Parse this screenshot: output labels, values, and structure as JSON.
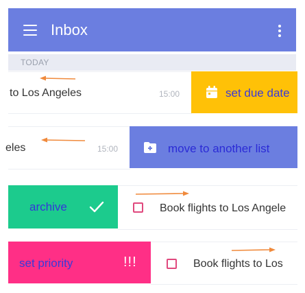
{
  "header": {
    "title": "Inbox"
  },
  "section": {
    "label": "TODAY"
  },
  "rows": [
    {
      "task": "to Los Angeles",
      "time": "15:00",
      "action_label": "set due date",
      "action_color": "#ffc107"
    },
    {
      "task": "eles",
      "time": "15:00",
      "action_label": "move to another list",
      "action_color": "#6b7ee0"
    },
    {
      "task": "Book flights to Los Angele",
      "action_label": "archive",
      "action_color": "#1ccb8d"
    },
    {
      "task": "Book flights to Los",
      "action_label": "set priority",
      "action_color": "#ff2f86",
      "priority_mark": "!!!"
    }
  ],
  "colors": {
    "header": "#6b7ee0",
    "arrow": "#f08a3c",
    "checkbox": "#e0487d"
  },
  "icons": {
    "menu": "hamburger-icon",
    "more": "more-vert-icon",
    "calendar": "calendar-icon",
    "move": "folder-move-icon",
    "check": "checkmark-icon"
  }
}
